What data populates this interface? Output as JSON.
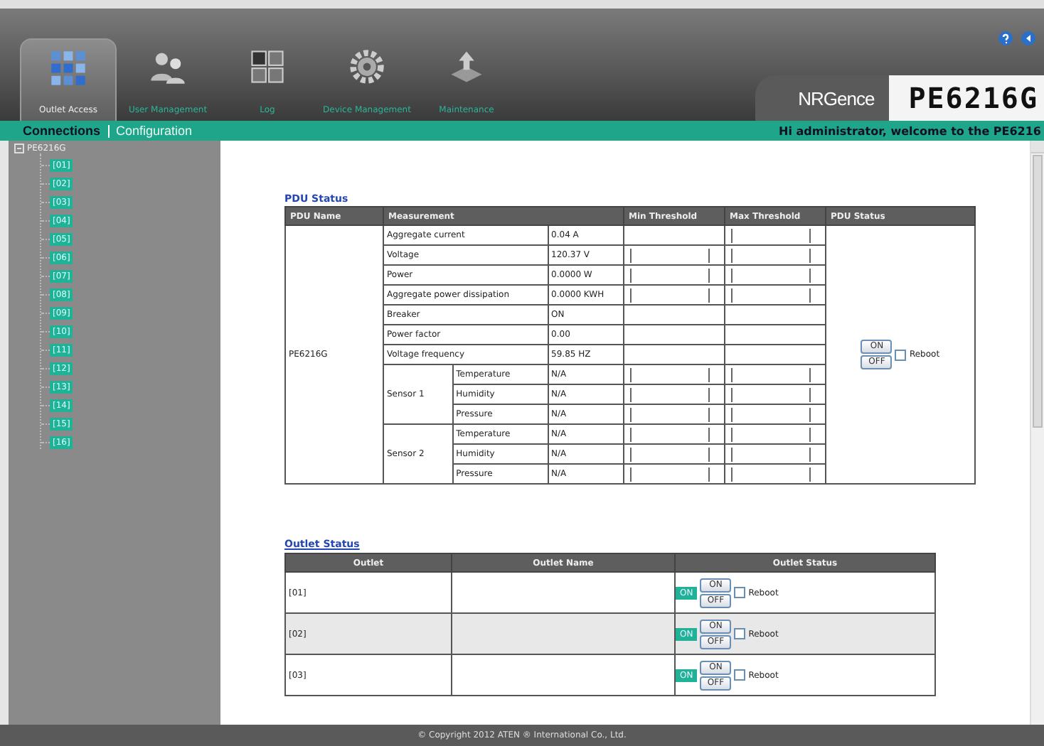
{
  "header": {
    "tabs": [
      {
        "label": "Outlet Access",
        "kind": "grid",
        "selected": true
      },
      {
        "label": "User Management",
        "kind": "users",
        "selected": false
      },
      {
        "label": "Log",
        "kind": "log",
        "selected": false
      },
      {
        "label": "Device Management",
        "kind": "gear",
        "selected": false
      },
      {
        "label": "Maintenance",
        "kind": "upload",
        "selected": false
      }
    ],
    "brand": "NRGence",
    "model": "PE6216G"
  },
  "nav": {
    "links": [
      {
        "label": "Connections",
        "selected": true
      },
      {
        "label": "Configuration",
        "selected": false
      }
    ],
    "welcome": "Hi administrator, welcome to the PE6216"
  },
  "sidebar": {
    "root": "PE6216G",
    "expanded": true,
    "children": [
      {
        "label": "[01]"
      },
      {
        "label": "[02]"
      },
      {
        "label": "[03]"
      },
      {
        "label": "[04]"
      },
      {
        "label": "[05]"
      },
      {
        "label": "[06]"
      },
      {
        "label": "[07]"
      },
      {
        "label": "[08]"
      },
      {
        "label": "[09]"
      },
      {
        "label": "[10]"
      },
      {
        "label": "[11]"
      },
      {
        "label": "[12]"
      },
      {
        "label": "[13]"
      },
      {
        "label": "[14]"
      },
      {
        "label": "[15]"
      },
      {
        "label": "[16]"
      }
    ]
  },
  "pdu_status": {
    "title": "PDU Status",
    "columns": [
      "PDU Name",
      "Measurement",
      "Min Threshold",
      "Max Threshold",
      "PDU Status"
    ],
    "pdu_name": "PE6216G",
    "measurements": [
      {
        "name": "Aggregate current",
        "value": "0.04 A",
        "min_field": false,
        "max_field": true
      },
      {
        "name": "Voltage",
        "value": "120.37 V",
        "min_field": true,
        "max_field": true
      },
      {
        "name": "Power",
        "value": "0.0000 W",
        "min_field": true,
        "max_field": true
      },
      {
        "name": "Aggregate power dissipation",
        "value": "0.0000 KWH",
        "min_field": true,
        "max_field": true
      },
      {
        "name": "Breaker",
        "value": "ON",
        "min_field": false,
        "max_field": false
      },
      {
        "name": "Power factor",
        "value": "0.00",
        "min_field": false,
        "max_field": false
      },
      {
        "name": "Voltage frequency",
        "value": "59.85 HZ",
        "min_field": false,
        "max_field": false
      }
    ],
    "sensors": [
      {
        "name": "Sensor 1",
        "readings": [
          {
            "name": "Temperature",
            "value": "N/A"
          },
          {
            "name": "Humidity",
            "value": "N/A"
          },
          {
            "name": "Pressure",
            "value": "N/A"
          }
        ]
      },
      {
        "name": "Sensor 2",
        "readings": [
          {
            "name": "Temperature",
            "value": "N/A"
          },
          {
            "name": "Humidity",
            "value": "N/A"
          },
          {
            "name": "Pressure",
            "value": "N/A"
          }
        ]
      }
    ],
    "on_button": "ON",
    "off_button": "OFF",
    "reboot": {
      "label": "Reboot",
      "checked": false
    }
  },
  "outlet_status": {
    "title": "Outlet Status",
    "columns": [
      "Outlet",
      "Outlet Name",
      "Outlet Status"
    ],
    "rows": [
      {
        "outlet": "[01]",
        "state": "ON",
        "on": true,
        "on_button": "ON",
        "off_button": "OFF",
        "reboot": {
          "label": "Reboot",
          "checked": false
        }
      },
      {
        "outlet": "[02]",
        "state": "ON",
        "on": true,
        "on_button": "ON",
        "off_button": "OFF",
        "reboot": {
          "label": "Reboot",
          "checked": false
        }
      },
      {
        "outlet": "[03]",
        "state": "ON",
        "on": true,
        "on_button": "ON",
        "off_button": "OFF",
        "reboot": {
          "label": "Reboot",
          "checked": false
        }
      }
    ]
  },
  "footer": "© Copyright 2012 ATEN ® International Co., Ltd."
}
